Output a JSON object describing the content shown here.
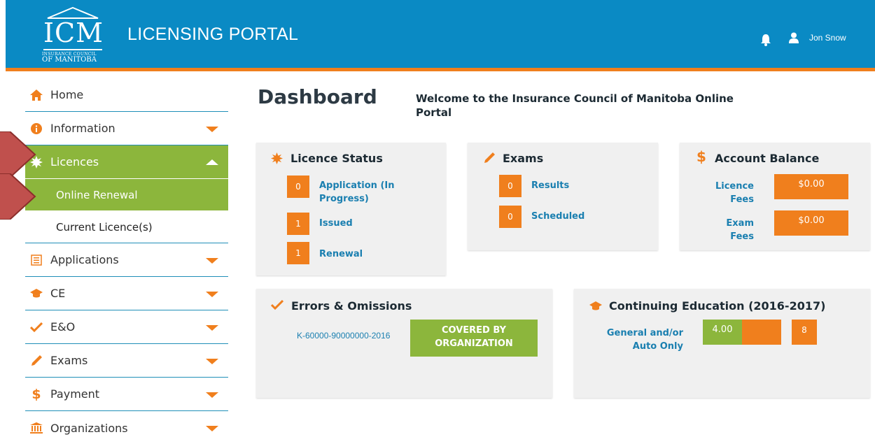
{
  "header": {
    "logo_mark": "ICM",
    "logo_subtitle_1": "INSURANCE COUNCIL",
    "logo_subtitle_2": "OF MANITOBA",
    "title": "LICENSING PORTAL",
    "bell_icon": "bell-icon",
    "user_icon": "user-icon",
    "user_name": "Jon Snow"
  },
  "sidebar": {
    "items": [
      {
        "label": "Home",
        "icon": "home-icon"
      },
      {
        "label": "Information",
        "icon": "info-icon"
      },
      {
        "label": "Licences",
        "icon": "badge-icon"
      },
      {
        "label": "Online Renewal"
      },
      {
        "label": "Current Licence(s)"
      },
      {
        "label": "Applications",
        "icon": "form-icon"
      },
      {
        "label": "CE",
        "icon": "graduation-cap-icon"
      },
      {
        "label": "E&O",
        "icon": "checkmark-icon"
      },
      {
        "label": "Exams",
        "icon": "pencil-icon"
      },
      {
        "label": "Payment",
        "icon": "dollar-icon"
      },
      {
        "label": "Organizations",
        "icon": "bank-icon"
      }
    ]
  },
  "main": {
    "title": "Dashboard",
    "welcome": "Welcome to the Insurance Council of Manitoba Online Portal",
    "licence_status": {
      "title": "Licence Status",
      "rows": [
        {
          "count": "0",
          "label": "Application (In Progress)"
        },
        {
          "count": "1",
          "label": "Issued"
        },
        {
          "count": "1",
          "label": "Renewal"
        }
      ]
    },
    "exams": {
      "title": "Exams",
      "rows": [
        {
          "count": "0",
          "label": "Results"
        },
        {
          "count": "0",
          "label": "Scheduled"
        }
      ]
    },
    "account_balance": {
      "title": "Account Balance",
      "rows": [
        {
          "label": "Licence Fees",
          "amount": "$0.00"
        },
        {
          "label": "Exam Fees",
          "amount": "$0.00"
        }
      ]
    },
    "errors_omissions": {
      "title": "Errors & Omissions",
      "policy": "K-60000-90000000-2016",
      "status": "COVERED BY ORGANIZATION"
    },
    "continuing_education": {
      "title": "Continuing Education (2016-2017)",
      "category": "General and/or Auto Only",
      "completed": "4.00",
      "required": "8",
      "progress_fraction": 0.5
    }
  },
  "colors": {
    "header_blue": "#0a8ac4",
    "accent_orange": "#f07f1d",
    "active_green": "#8cb63c",
    "link_blue": "#1a7fb0"
  }
}
